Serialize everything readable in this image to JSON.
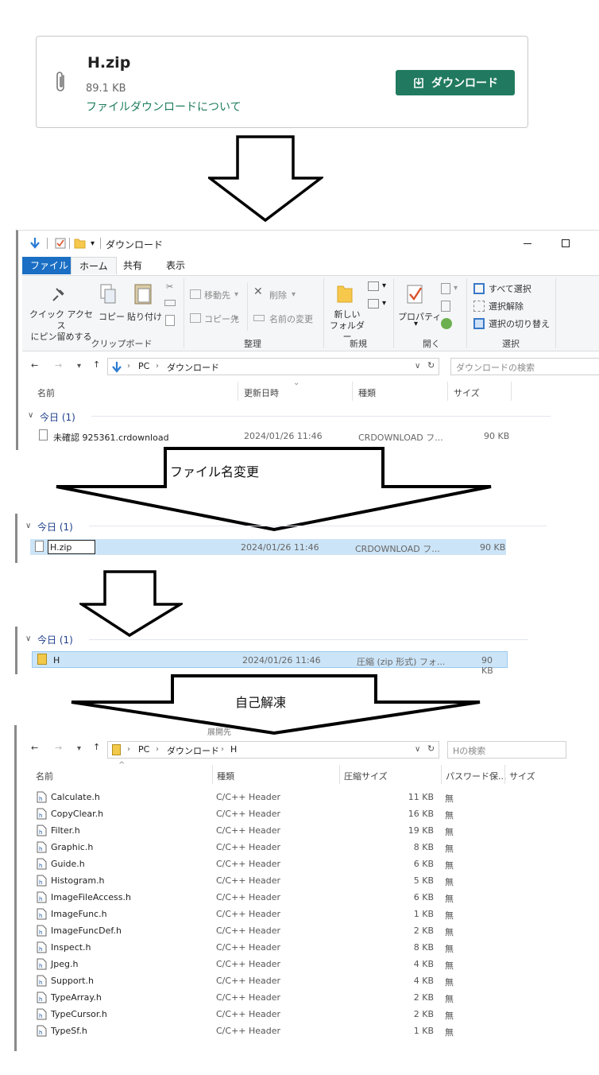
{
  "download_card": {
    "filename": "H.zip",
    "size": "89.1 KB",
    "about_link": "ファイルダウンロードについて",
    "download_button": "ダウンロード"
  },
  "explorer1": {
    "title": "ダウンロード",
    "tabs": [
      "ファイル",
      "ホーム",
      "共有",
      "表示"
    ],
    "ribbon": {
      "pin": "クイック アクセス\nにピン留めする",
      "copy": "コピー",
      "paste": "貼り付け",
      "move_to": "移動先",
      "copy_to": "コピー先",
      "delete": "削除",
      "rename": "名前の変更",
      "new_folder": "新しい\nフォルダー",
      "properties": "プロパティ",
      "select_all": "すべて選択",
      "select_none": "選択解除",
      "invert_selection": "選択の切り替え",
      "groups": [
        "クリップボード",
        "整理",
        "新規",
        "開く",
        "選択"
      ]
    },
    "breadcrumb": [
      "PC",
      "ダウンロード"
    ],
    "search_placeholder": "ダウンロードの検索",
    "columns": [
      "名前",
      "更新日時",
      "種類",
      "サイズ"
    ],
    "group_header": "今日 (1)",
    "file": {
      "name": "未確認 925361.crdownload",
      "date": "2024/01/26 11:46",
      "type": "CRDOWNLOAD フ...",
      "size": "90 KB"
    }
  },
  "arrow1_label": "ファイル名変更",
  "explorer2": {
    "group_header": "今日 (1)",
    "file": {
      "name": "H.zip",
      "date": "2024/01/26 11:46",
      "type": "CRDOWNLOAD フ...",
      "size": "90 KB"
    }
  },
  "explorer3": {
    "group_header": "今日 (1)",
    "file": {
      "name": "H",
      "date": "2024/01/26 11:46",
      "type": "圧縮 (zip 形式) フォ...",
      "size": "90 KB"
    }
  },
  "arrow3_label": "自己解凍",
  "explorer4": {
    "partial_header": "展開先",
    "breadcrumb": [
      "PC",
      "ダウンロード",
      "H"
    ],
    "search_placeholder": "Hの検索",
    "columns": [
      "名前",
      "種類",
      "圧縮サイズ",
      "パスワード保...",
      "サイズ"
    ],
    "files": [
      {
        "name": "Calculate.h",
        "type": "C/C++ Header",
        "size": "11 KB",
        "pw": "無"
      },
      {
        "name": "CopyClear.h",
        "type": "C/C++ Header",
        "size": "16 KB",
        "pw": "無"
      },
      {
        "name": "Filter.h",
        "type": "C/C++ Header",
        "size": "19 KB",
        "pw": "無"
      },
      {
        "name": "Graphic.h",
        "type": "C/C++ Header",
        "size": "8 KB",
        "pw": "無"
      },
      {
        "name": "Guide.h",
        "type": "C/C++ Header",
        "size": "6 KB",
        "pw": "無"
      },
      {
        "name": "Histogram.h",
        "type": "C/C++ Header",
        "size": "5 KB",
        "pw": "無"
      },
      {
        "name": "ImageFileAccess.h",
        "type": "C/C++ Header",
        "size": "6 KB",
        "pw": "無"
      },
      {
        "name": "ImageFunc.h",
        "type": "C/C++ Header",
        "size": "1 KB",
        "pw": "無"
      },
      {
        "name": "ImageFuncDef.h",
        "type": "C/C++ Header",
        "size": "2 KB",
        "pw": "無"
      },
      {
        "name": "Inspect.h",
        "type": "C/C++ Header",
        "size": "8 KB",
        "pw": "無"
      },
      {
        "name": "Jpeg.h",
        "type": "C/C++ Header",
        "size": "4 KB",
        "pw": "無"
      },
      {
        "name": "Support.h",
        "type": "C/C++ Header",
        "size": "4 KB",
        "pw": "無"
      },
      {
        "name": "TypeArray.h",
        "type": "C/C++ Header",
        "size": "2 KB",
        "pw": "無"
      },
      {
        "name": "TypeCursor.h",
        "type": "C/C++ Header",
        "size": "2 KB",
        "pw": "無"
      },
      {
        "name": "TypeSf.h",
        "type": "C/C++ Header",
        "size": "1 KB",
        "pw": "無"
      }
    ]
  }
}
